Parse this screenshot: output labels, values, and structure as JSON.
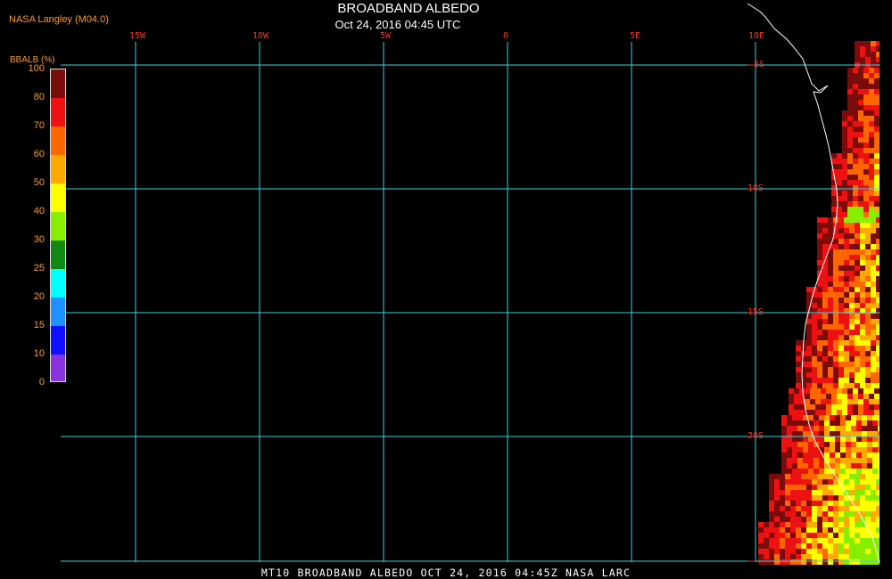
{
  "header": {
    "credit": "NASA Langley (M04.0)",
    "title": "BROADBAND ALBEDO",
    "subtitle": "Oct 24, 2016 04:45 UTC"
  },
  "legend": {
    "unit": "BBALB (%)",
    "labels": [
      "100",
      "80",
      "70",
      "60",
      "50",
      "40",
      "30",
      "25",
      "20",
      "15",
      "10",
      "0"
    ],
    "colors": [
      "#7b0c0c",
      "#ee1111",
      "#ff6600",
      "#ffaa00",
      "#ffff00",
      "#88ee00",
      "#118811",
      "#00ffff",
      "#1e90ff",
      "#1010ff",
      "#8833dd"
    ]
  },
  "map": {
    "lon_labels": [
      "15W",
      "10W",
      "5W",
      "0",
      "5E",
      "10E"
    ],
    "lat_labels": [
      "5S",
      "10S",
      "15S",
      "20S"
    ],
    "grid_color": "#3ad6e0",
    "coast_color": "#ffffff"
  },
  "footer": {
    "text": "MT10  BROADBAND ALBEDO   OCT 24, 2016 04:45Z   NASA LARC"
  }
}
